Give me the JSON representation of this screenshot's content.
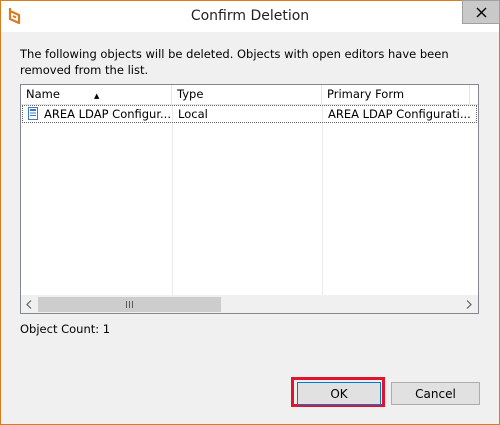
{
  "window": {
    "title": "Confirm Deletion",
    "accent_color": "#d97b1f",
    "app_icon": "app-logo-icon",
    "close_icon": "close-icon"
  },
  "message": "The following objects will be deleted. Objects with open editors have been removed from the list.",
  "table": {
    "columns": [
      "Name",
      "Type",
      "Primary Form"
    ],
    "sorted_column": "Name",
    "sort_direction": "ascending",
    "rows": [
      {
        "icon": "form-document-icon",
        "name": "AREA LDAP Configur...",
        "type": "Local",
        "primary_form": "AREA LDAP Configurati..."
      }
    ]
  },
  "object_count_label": "Object Count: 1",
  "buttons": {
    "ok_label": "OK",
    "cancel_label": "Cancel"
  },
  "highlight_color": "#e2132d"
}
